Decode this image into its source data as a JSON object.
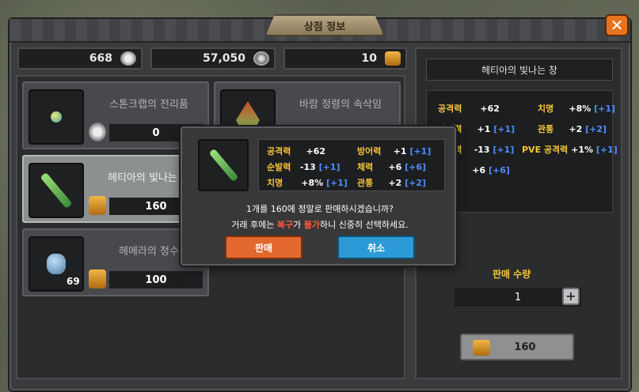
{
  "window": {
    "title": "상점 정보"
  },
  "currencies": [
    {
      "value": "668",
      "icon": "gear-coin-icon"
    },
    {
      "value": "57,050",
      "icon": "compass-icon"
    },
    {
      "value": "10",
      "icon": "gold-token-icon"
    }
  ],
  "shop_items": [
    {
      "name": "스톤크랩의 전리품",
      "price": "0",
      "qty": "",
      "price_icon": "gear-coin-icon"
    },
    {
      "name": "바람 정령의 속삭임",
      "price": "",
      "qty": "",
      "price_icon": ""
    },
    {
      "name": "헤티아의 빛나는 창",
      "price": "160",
      "qty": "",
      "price_icon": "gold-token-icon"
    },
    {
      "name": "헤메라의 정수",
      "price": "100",
      "qty": "69",
      "price_icon": "gold-token-icon"
    }
  ],
  "detail": {
    "title": "헤티아의 빛나는 창",
    "stats": [
      {
        "label": "공격력",
        "value": "+62",
        "bonus": ""
      },
      {
        "label": "치명",
        "value": "+8%",
        "bonus": "[+1]"
      },
      {
        "label": "방어력",
        "value": "+1",
        "bonus": "[+1]"
      },
      {
        "label": "관통",
        "value": "+2",
        "bonus": "[+2]"
      },
      {
        "label": "순발력",
        "value": "-13",
        "bonus": "[+1]"
      },
      {
        "label": "PVE 공격력",
        "value": "+1%",
        "bonus": "[+1]"
      },
      {
        "label": "체력",
        "value": "+6",
        "bonus": "[+6]"
      }
    ],
    "sell_qty_label": "판매 수량",
    "qty_value": "1",
    "minus": "−",
    "plus": "+",
    "total": "160"
  },
  "dialog": {
    "stats": [
      {
        "label": "공격력",
        "value": "+62",
        "bonus": ""
      },
      {
        "label": "방어력",
        "value": "+1",
        "bonus": "[+1]"
      },
      {
        "label": "순발력",
        "value": "-13",
        "bonus": "[+1]"
      },
      {
        "label": "체력",
        "value": "+6",
        "bonus": "[+6]"
      },
      {
        "label": "치명",
        "value": "+8%",
        "bonus": "[+1]"
      },
      {
        "label": "관통",
        "value": "+2",
        "bonus": "[+2]"
      }
    ],
    "line1": "1개를 160에 정말로 판매하시겠습니까?",
    "line2_a": "거래 후에는 ",
    "line2_b": "복구",
    "line2_c": "가 ",
    "line2_d": "불가",
    "line2_e": "하니 신중히 선택하세요.",
    "sell_label": "판매",
    "cancel_label": "취소"
  },
  "colors": {
    "stat_label": "#f4c63a",
    "bonus": "#4f8dff",
    "sell": "#e2682d",
    "cancel": "#2c9ad6",
    "warning": "#ff5a3a"
  }
}
